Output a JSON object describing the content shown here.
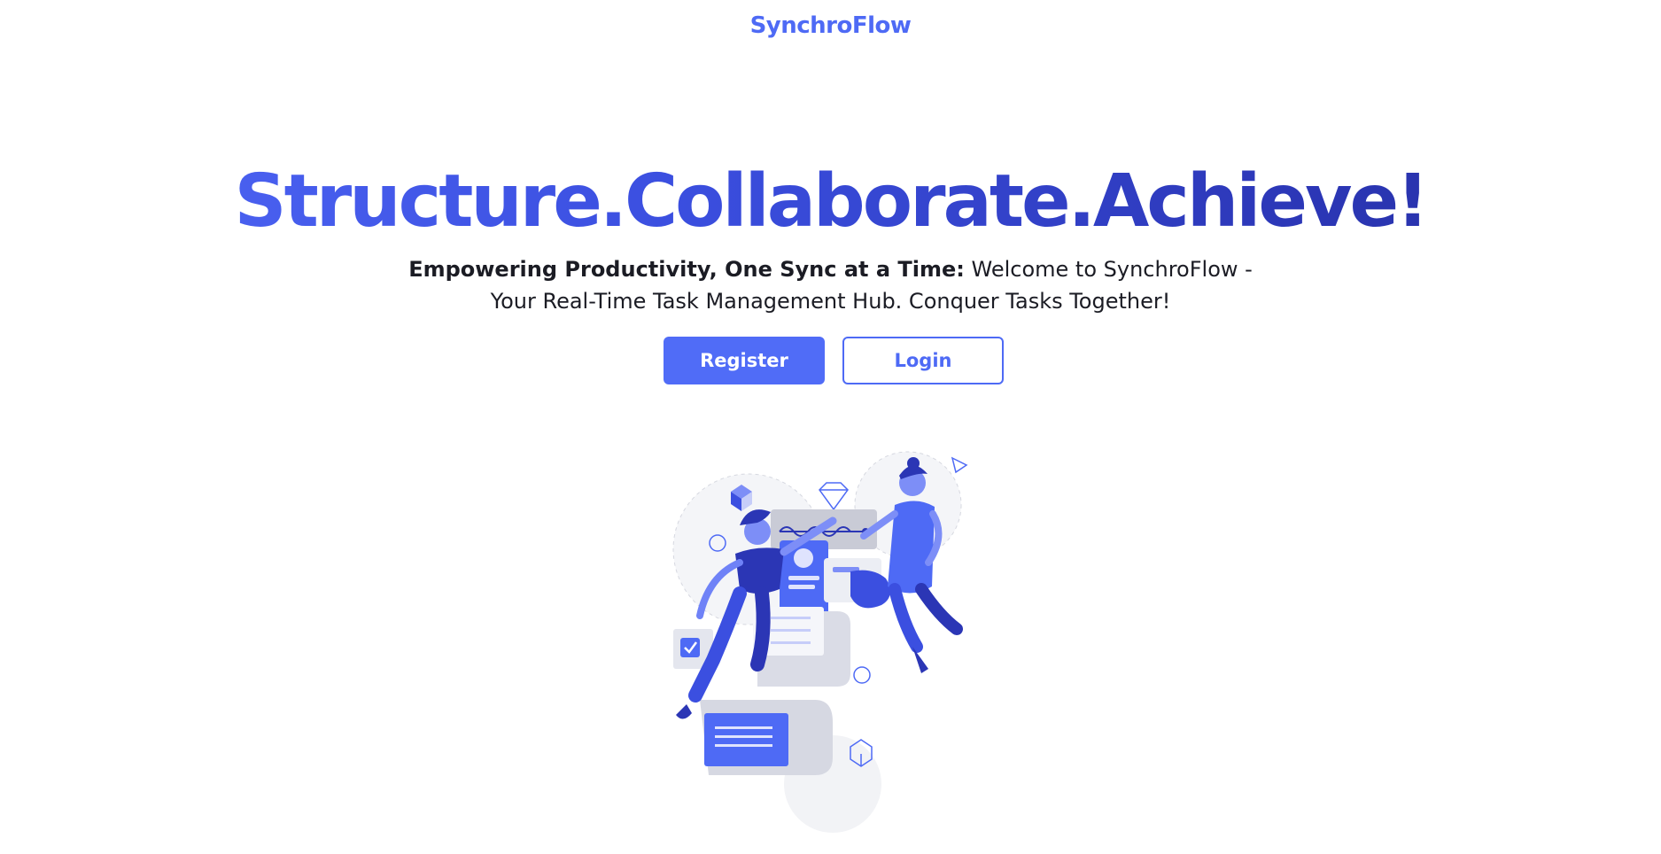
{
  "header": {
    "brand": "SynchroFlow"
  },
  "hero": {
    "title": "Structure.Collaborate.Achieve!",
    "tagline_bold": "Empowering Productivity, One Sync at a Time:",
    "tagline_rest": " Welcome to SynchroFlow - Your Real-Time Task Management Hub. Conquer Tasks Together!"
  },
  "actions": {
    "register_label": "Register",
    "login_label": "Login"
  },
  "colors": {
    "accent": "#4e6af5",
    "dark_accent": "#27309f",
    "text": "#1b1c24"
  }
}
